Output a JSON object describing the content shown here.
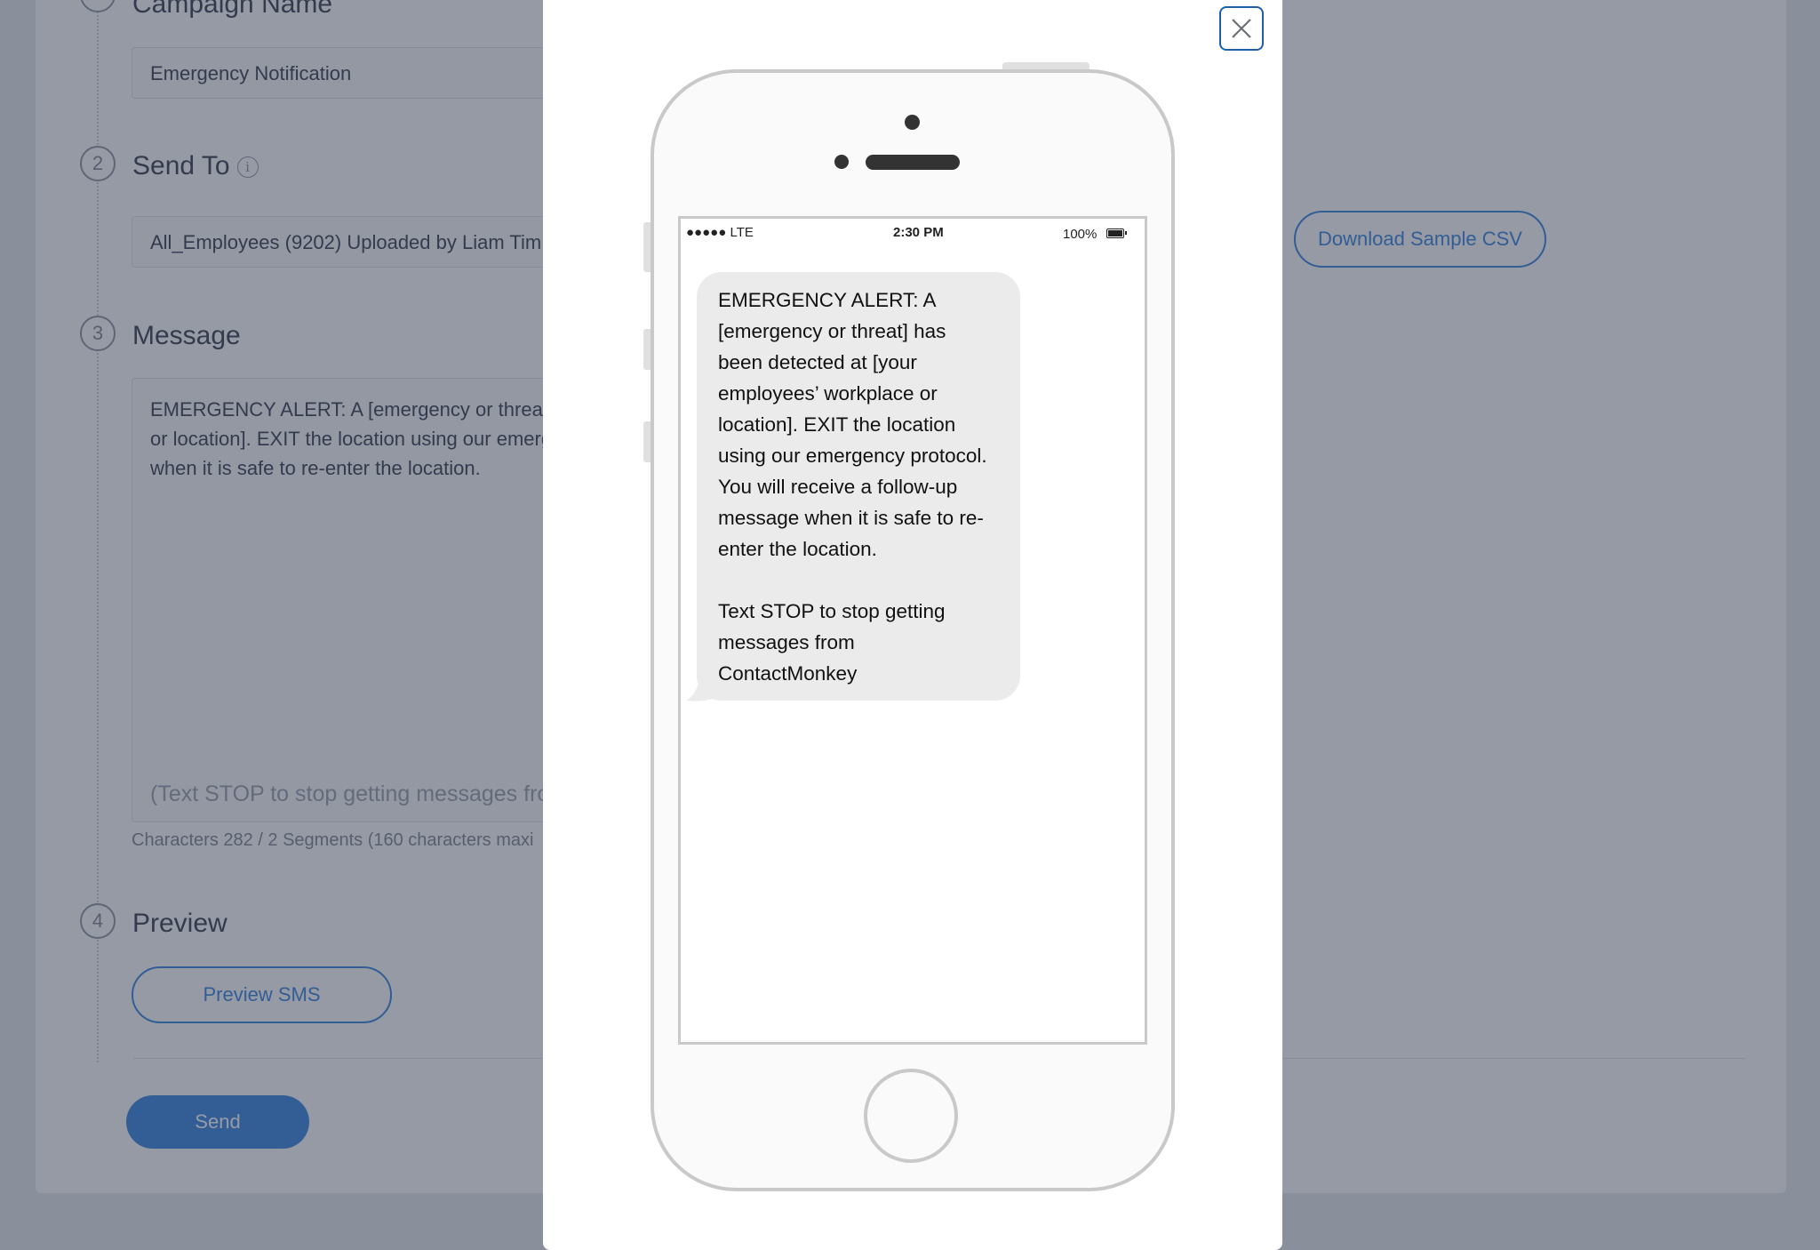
{
  "form": {
    "campaign_name_title": "Campaign Name",
    "campaign_name_value": "Emergency Notification",
    "send_to": {
      "step": "2",
      "title": "Send To",
      "info_icon": "i",
      "value": "All_Employees (9202) Uploaded by Liam Tim",
      "download_label": "Download Sample CSV"
    },
    "message": {
      "step": "3",
      "title": "Message",
      "body": "EMERGENCY ALERT: A [emergency or threat] has been detected at [your employees' workplace or location]. EXIT the location using our emergency protocol. You will receive a follow-up message when it is safe to re-enter the location.",
      "footer": "(Text STOP to stop getting messages fro",
      "char_count": "Characters 282 / 2 Segments (160 characters maxi"
    },
    "preview": {
      "step": "4",
      "title": "Preview",
      "button_label": "Preview SMS"
    },
    "send_label": "Send"
  },
  "modal": {
    "close_icon": "close-icon",
    "phone": {
      "status_carrier": "●●●●● LTE",
      "status_time": "2:30 PM",
      "status_battery": "100%",
      "sms_paragraph_1": "EMERGENCY ALERT: A\n[emergency or threat] has\nbeen detected at [your\nemployees’ workplace or\nlocation]. EXIT the location\nusing our emergency protocol.\nYou will receive a follow-up\nmessage when it is safe to re-\nenter the location.",
      "sms_paragraph_2": "Text STOP to stop getting\nmessages from\nContactMonkey"
    }
  },
  "colors": {
    "accent": "#4a90e2",
    "overlay": "#162038",
    "bubble": "#ebebeb"
  }
}
